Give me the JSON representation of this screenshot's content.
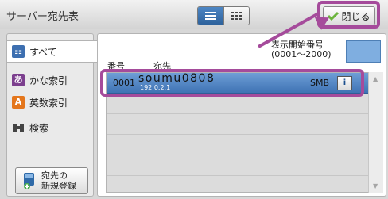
{
  "header": {
    "title": "サーバー宛先表",
    "close_label": "閉じる",
    "view_options": [
      "list-icon",
      "grid-icon"
    ]
  },
  "sidebar": {
    "tabs": [
      {
        "label": "すべて",
        "icon": "all-icon",
        "icon_text": "☷"
      },
      {
        "label": "かな索引",
        "icon": "kana-index-icon",
        "icon_text": "あ"
      },
      {
        "label": "英数索引",
        "icon": "alnum-index-icon",
        "icon_text": "A"
      },
      {
        "label": "検索",
        "icon": "binoculars-icon",
        "icon_text": "⛶"
      }
    ],
    "register_line1": "宛先の",
    "register_line2": "新規登録"
  },
  "main": {
    "start_label_line1": "表示開始番号",
    "start_label_line2": "(0001～2000)",
    "col_number": "番号",
    "col_destination": "宛先",
    "rows": [
      {
        "number": "0001",
        "name": "soumu0808",
        "ip": "192.0.2.1",
        "type": "SMB",
        "info": "i"
      }
    ]
  },
  "colors": {
    "highlight": "#a54b9b",
    "selected_row": "#4b7fc0",
    "accent": "#7faee0"
  }
}
